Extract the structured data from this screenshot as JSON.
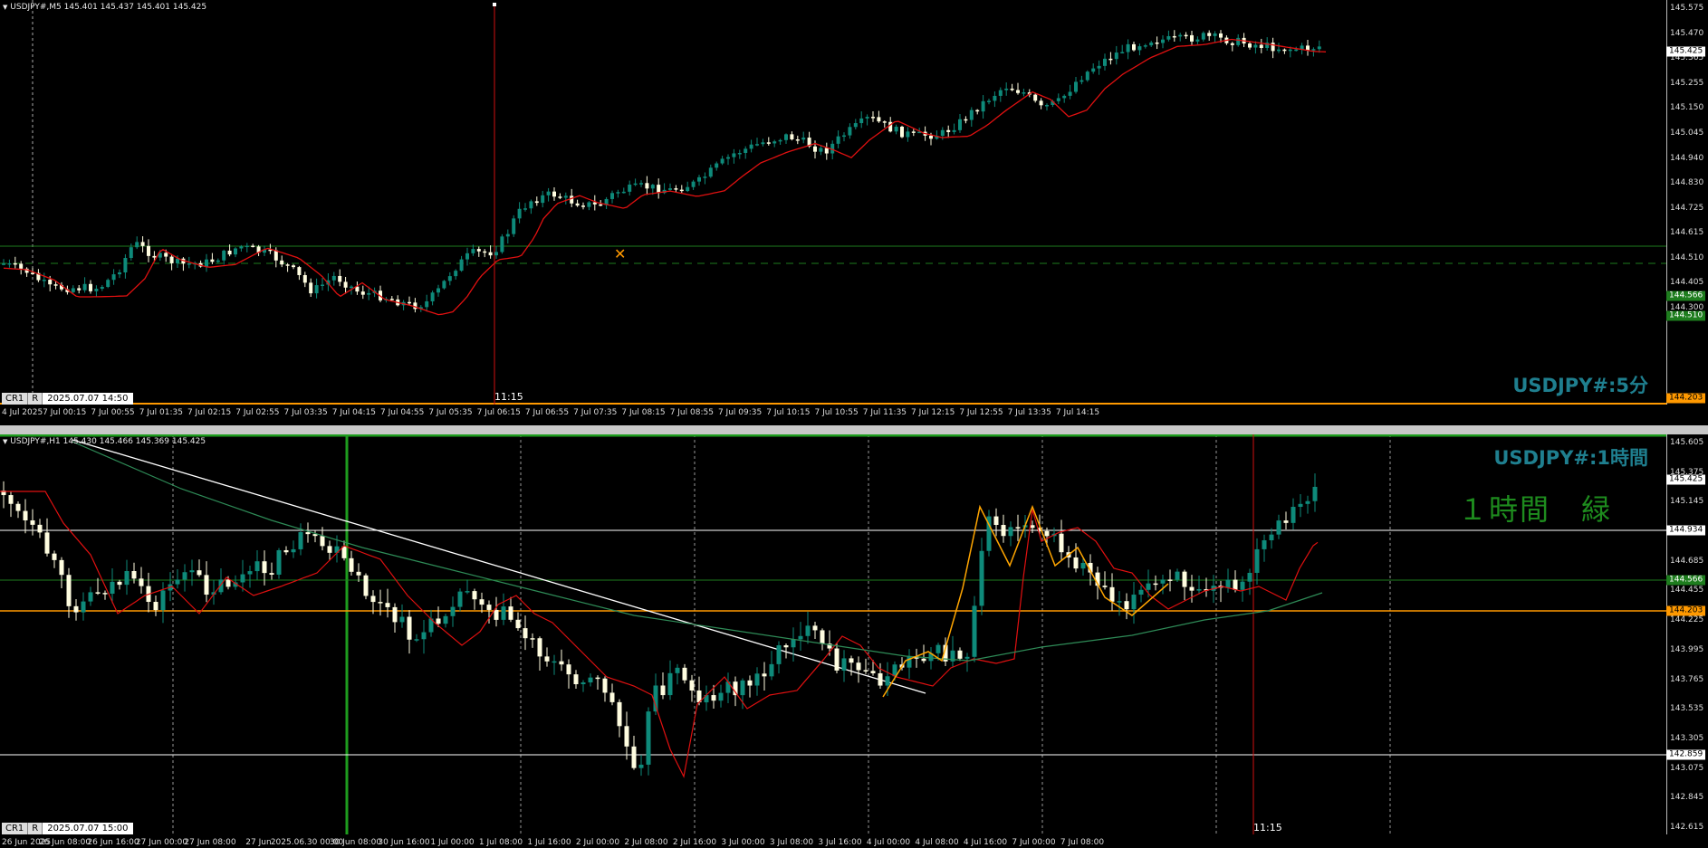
{
  "top_pane": {
    "info": "USDJPY#,M5  145.401 145.437 145.401 145.425",
    "timeframe_label": "USDJPY#:5分",
    "cursor_time": "11:15",
    "crosshair_buttons": [
      "CR1",
      "R"
    ],
    "crosshair_datetime": "2025.07.07  14:50",
    "price_scale": [
      "145.575",
      "145.470",
      "145.365",
      "145.255",
      "145.150",
      "145.045",
      "144.940",
      "144.830",
      "144.725",
      "144.615",
      "144.510",
      "144.405",
      "144.300"
    ],
    "price_tags": {
      "current": "145.425",
      "green": "144.566",
      "dashed": "144.510",
      "orange": "144.203"
    },
    "time_scale": [
      "4 Jul 2025",
      "7 Jul 00:15",
      "7 Jul 00:55",
      "7 Jul 01:35",
      "7 Jul 02:15",
      "7 Jul 02:55",
      "7 Jul 03:35",
      "7 Jul 04:15",
      "7 Jul 04:55",
      "7 Jul 05:35",
      "7 Jul 06:15",
      "7 Jul 06:55",
      "7 Jul 07:35",
      "7 Jul 08:15",
      "7 Jul 08:55",
      "7 Jul 09:35",
      "7 Jul 10:15",
      "7 Jul 10:55",
      "7 Jul 11:35",
      "7 Jul 12:15",
      "7 Jul 12:55",
      "7 Jul 13:35",
      "7 Jul 14:15"
    ]
  },
  "bottom_pane": {
    "info": "USDJPY#,H1  145.430 145.466 145.369 145.425",
    "timeframe_label": "USDJPY#:1時間",
    "note_label": "１時間　緑",
    "cursor_time": "11:15",
    "crosshair_buttons": [
      "CR1",
      "R"
    ],
    "crosshair_datetime": "2025.07.07  15:00",
    "price_scale": [
      "145.605",
      "145.375",
      "145.145",
      "144.915",
      "144.685",
      "144.455",
      "144.225",
      "143.995",
      "143.765",
      "143.535",
      "143.305",
      "143.075",
      "142.845",
      "142.615"
    ],
    "price_tags": {
      "current": "145.425",
      "white_top": "144.934",
      "green": "144.566",
      "orange": "144.203",
      "white_bottom": "142.859"
    },
    "time_scale": [
      "26 Jun 2025",
      "26 Jun 08:00",
      "26 Jun 16:00",
      "27 Jun 00:00",
      "27 Jun 08:00",
      "27 Jun",
      "2025.06.30 00:00",
      "30 Jun 08:00",
      "30 Jun 16:00",
      "1 Jul 00:00",
      "1 Jul 08:00",
      "1 Jul 16:00",
      "2 Jul 00:00",
      "2 Jul 08:00",
      "2 Jul 16:00",
      "3 Jul 00:00",
      "3 Jul 08:00",
      "3 Jul 16:00",
      "4 Jul 00:00",
      "4 Jul 08:00",
      "4 Jul 16:00",
      "7 Jul 00:00",
      "7 Jul 08:00"
    ]
  },
  "colors": {
    "bull": "#0e8a7a",
    "bear": "#fffde0",
    "ma_red": "#e01010",
    "ma_green": "#2e8b57",
    "hline_green": "#1e7d1e",
    "hline_orange": "#ff9900",
    "cursor_red": "#d01010",
    "zigzag": "#ffa500"
  }
}
